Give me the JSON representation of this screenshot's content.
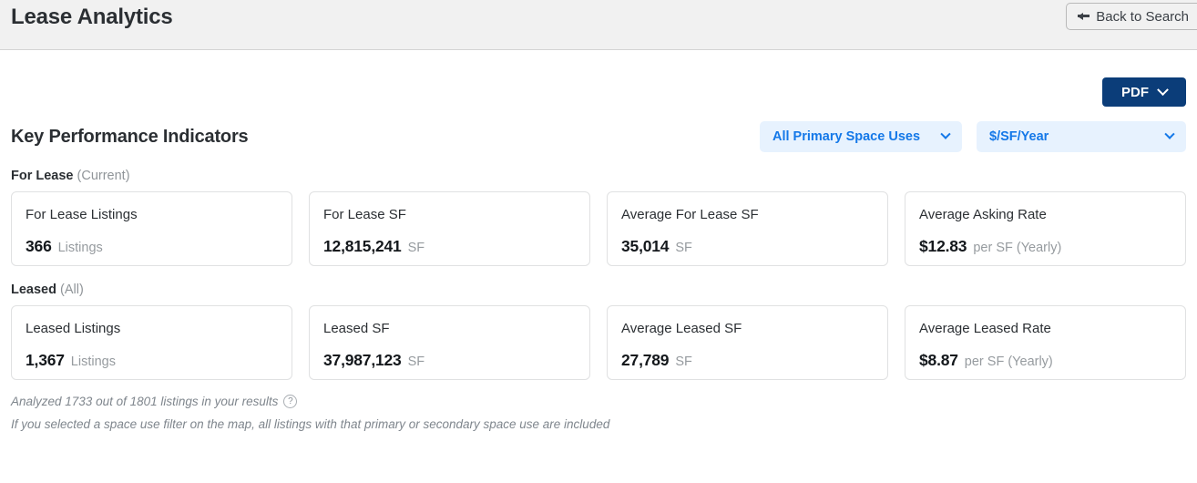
{
  "header": {
    "title": "Lease Analytics",
    "back_button": "Back to Search",
    "back_icon": "arrow-left-icon"
  },
  "toolbar": {
    "pdf_label": "PDF",
    "pdf_icon": "chevron-down-icon",
    "pdf_color": "#0b3d79"
  },
  "kpi": {
    "heading": "Key Performance Indicators",
    "filters": [
      {
        "label": "All Primary Space Uses",
        "icon": "chevron-down-icon"
      },
      {
        "label": "$/SF/Year",
        "icon": "chevron-down-icon"
      }
    ],
    "accent_color": "#1478e8",
    "filter_bg": "#e7f2fe"
  },
  "sections": [
    {
      "name": "For Lease",
      "qualifier": "(Current)",
      "cards": [
        {
          "label": "For Lease Listings",
          "value": "366",
          "unit": "Listings"
        },
        {
          "label": "For Lease SF",
          "value": "12,815,241",
          "unit": "SF"
        },
        {
          "label": "Average For Lease SF",
          "value": "35,014",
          "unit": "SF"
        },
        {
          "label": "Average Asking Rate",
          "value": "$12.83",
          "unit": "per SF (Yearly)"
        }
      ]
    },
    {
      "name": "Leased",
      "qualifier": "(All)",
      "cards": [
        {
          "label": "Leased Listings",
          "value": "1,367",
          "unit": "Listings"
        },
        {
          "label": "Leased SF",
          "value": "37,987,123",
          "unit": "SF"
        },
        {
          "label": "Average Leased SF",
          "value": "27,789",
          "unit": "SF"
        },
        {
          "label": "Average Leased Rate",
          "value": "$8.87",
          "unit": "per SF (Yearly)"
        }
      ]
    }
  ],
  "footnotes": {
    "line1": "Analyzed 1733 out of 1801 listings in your results",
    "help_icon": "question-mark-icon",
    "line2": "If you selected a space use filter on the map, all listings with that primary or secondary space use are included"
  }
}
